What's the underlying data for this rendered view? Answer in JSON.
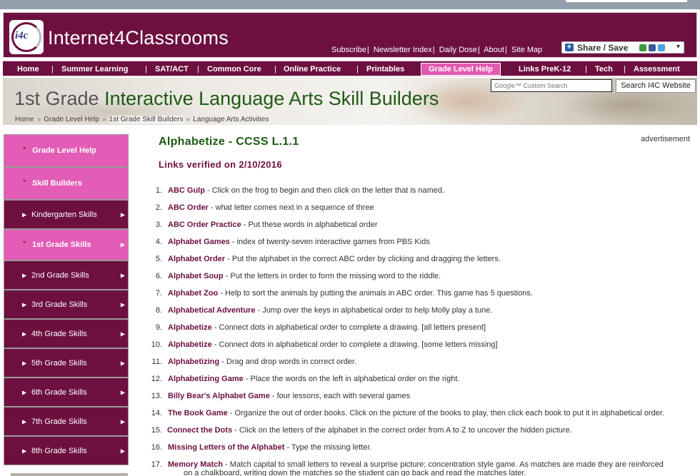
{
  "header": {
    "logo_text": "i4c",
    "site_name": "Internet4Classrooms",
    "top_links": [
      "Subscribe",
      "Newsletter Index",
      "Daily Dose",
      "About",
      "Site Map"
    ],
    "share_label": "Share / Save"
  },
  "nav": {
    "items": [
      "Home",
      "Summer Learning",
      "SAT/ACT",
      "Common Core",
      "Online Practice",
      "Printables",
      "Grade Level Help",
      "Links PreK-12",
      "Tech",
      "Assessment"
    ],
    "active": "Grade Level Help"
  },
  "banner": {
    "heading_grade": "1st Grade",
    "heading_rest": " Interactive Language Arts Skill Builders",
    "breadcrumb": [
      "Home",
      "Grade Level Help",
      "1st Grade Skill Builders",
      "Language Arts Activities"
    ],
    "breadcrumb_sep": "»",
    "search_placeholder": "Google™ Custom Search",
    "search_button": "Search I4C Website"
  },
  "sidebar": {
    "items": [
      {
        "label": "Grade Level Help",
        "style": "pink"
      },
      {
        "label": "Skill Builders",
        "style": "pink"
      },
      {
        "label": "Kindergarten Skills",
        "style": "dark"
      },
      {
        "label": "1st Grade Skills",
        "style": "active"
      },
      {
        "label": "2nd Grade Skills",
        "style": "dark"
      },
      {
        "label": "3rd Grade Skills",
        "style": "dark"
      },
      {
        "label": "4th Grade Skills",
        "style": "dark"
      },
      {
        "label": "5th Grade Skills",
        "style": "dark"
      },
      {
        "label": "6th Grade Skills",
        "style": "dark"
      },
      {
        "label": "7th Grade Skills",
        "style": "dark"
      },
      {
        "label": "8th Grade Skills",
        "style": "dark"
      }
    ]
  },
  "main": {
    "title": "Alphabetize - CCSS L.1.1",
    "verified": "Links verified on 2/10/2016",
    "ad_label": "advertisement",
    "links": [
      {
        "num": "1.",
        "title": "ABC Gulp",
        "desc": " - Click on the frog to begin and then click on the letter that is named."
      },
      {
        "num": "2.",
        "title": "ABC Order",
        "desc": " - what letter comes next in a sequence of three"
      },
      {
        "num": "3.",
        "title": "ABC Order Practice",
        "desc": " - Put these words in alphabetical order"
      },
      {
        "num": "4.",
        "title": "Alphabet Games",
        "desc": " - index of twenty-seven interactive games from PBS Kids"
      },
      {
        "num": "5.",
        "title": "Alphabet Order",
        "desc": " - Put the alphabet in the correct ABC order by clicking and dragging the letters."
      },
      {
        "num": "6.",
        "title": "Alphabet Soup",
        "desc": " - Put the letters in order to form the missing word to the riddle."
      },
      {
        "num": "7.",
        "title": "Alphabet Zoo",
        "desc": " - Help to sort the animals by putting the animals in ABC order. This game has 5 questions."
      },
      {
        "num": "8.",
        "title": "Alphabetical Adventure",
        "desc": " - Jump over the keys in alphabetical order to help Molly play a tune."
      },
      {
        "num": "9.",
        "title": "Alphabetize",
        "desc": " - Connect dots in alphabetical order to complete a drawing. [all letters present]"
      },
      {
        "num": "10.",
        "title": "Alphabetize",
        "desc": " - Connect dots in alphabetical order to complete a drawing. [some letters missing]"
      },
      {
        "num": "11.",
        "title": "Alphabetizing",
        "desc": " - Drag and drop words in correct order."
      },
      {
        "num": "12.",
        "title": "Alphabetizing Game",
        "desc": " - Place the words on the left in alphabetical order on the right."
      },
      {
        "num": "13.",
        "title": "Billy Bear's Alphabet Game",
        "desc": " - four lessons, each with several games"
      },
      {
        "num": "14.",
        "title": "The Book Game",
        "desc": " - Organize the out of order books. Click on the picture of the books to play, then click each book to put it in alphabetical order."
      },
      {
        "num": "15.",
        "title": "Connect the Dots",
        "desc": " - Click on the letters of the alphabet in the correct order from A to Z to uncover the hidden picture."
      },
      {
        "num": "16.",
        "title": "Missing Letters of the Alphabet",
        "desc": " - Type the missing letter."
      },
      {
        "num": "17.",
        "title": "Memory Match",
        "desc": " - Match capital to small letters to reveal a surprise picture; concentration style game. As matches are made they are reinforced",
        "desc2": "on a chalkboard, writing down the matches so the student can go back and read the matches later."
      }
    ]
  }
}
